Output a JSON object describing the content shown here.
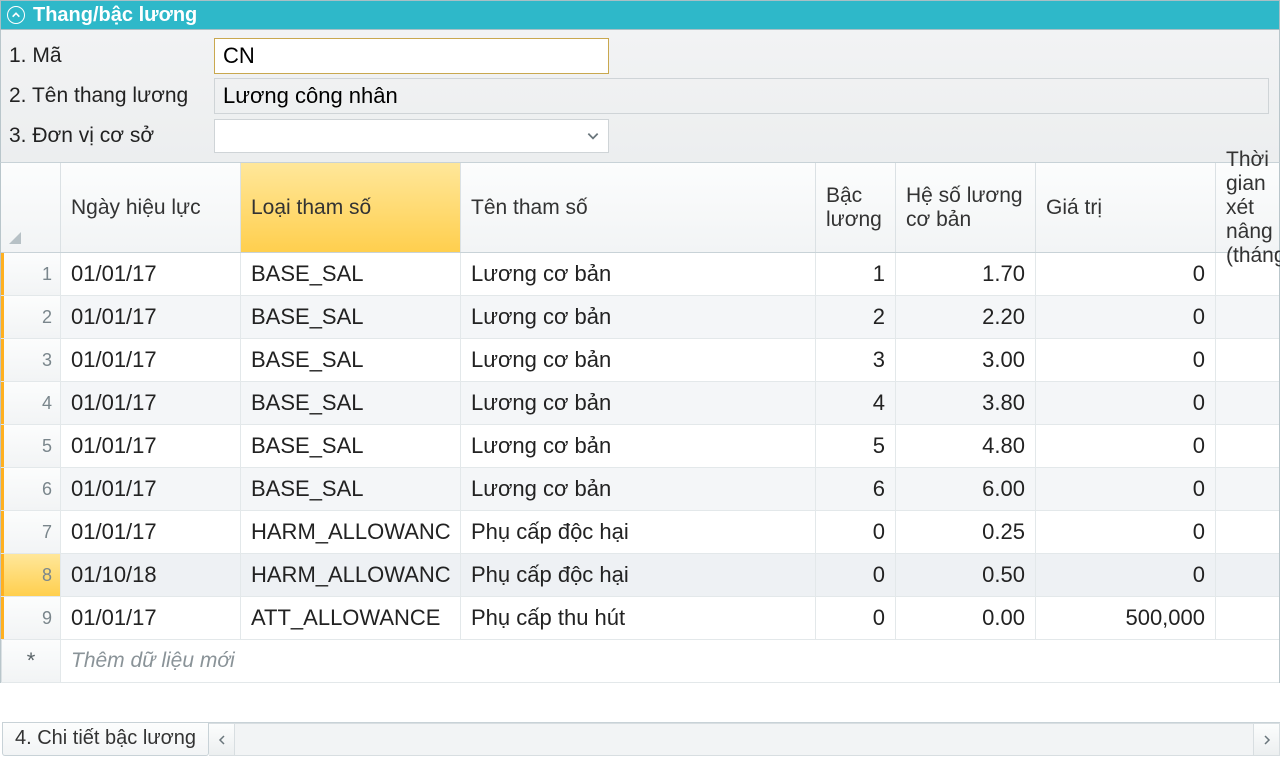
{
  "panel": {
    "title": "Thang/bậc lương"
  },
  "form": {
    "labels": {
      "code": "1. Mã",
      "name": "2. Tên thang lương",
      "unit": "3. Đơn vị cơ sở"
    },
    "values": {
      "code": "CN",
      "name": "Lương công nhân",
      "unit": ""
    }
  },
  "grid": {
    "columns": {
      "date": "Ngày hiệu lực",
      "paramType": "Loại tham số",
      "paramName": "Tên tham số",
      "level": "Bậc lương",
      "coef": "Hệ số lương cơ bản",
      "value": "Giá trị",
      "period": "Thời gian xét nâng (tháng)"
    },
    "rows": [
      {
        "n": "1",
        "date": "01/01/17",
        "type": "BASE_SAL",
        "name": "Lương cơ bản",
        "level": "1",
        "coef": "1.70",
        "value": "0",
        "period": ""
      },
      {
        "n": "2",
        "date": "01/01/17",
        "type": "BASE_SAL",
        "name": "Lương cơ bản",
        "level": "2",
        "coef": "2.20",
        "value": "0",
        "period": ""
      },
      {
        "n": "3",
        "date": "01/01/17",
        "type": "BASE_SAL",
        "name": "Lương cơ bản",
        "level": "3",
        "coef": "3.00",
        "value": "0",
        "period": ""
      },
      {
        "n": "4",
        "date": "01/01/17",
        "type": "BASE_SAL",
        "name": "Lương cơ bản",
        "level": "4",
        "coef": "3.80",
        "value": "0",
        "period": ""
      },
      {
        "n": "5",
        "date": "01/01/17",
        "type": "BASE_SAL",
        "name": "Lương cơ bản",
        "level": "5",
        "coef": "4.80",
        "value": "0",
        "period": ""
      },
      {
        "n": "6",
        "date": "01/01/17",
        "type": "BASE_SAL",
        "name": "Lương cơ bản",
        "level": "6",
        "coef": "6.00",
        "value": "0",
        "period": ""
      },
      {
        "n": "7",
        "date": "01/01/17",
        "type": "HARM_ALLOWANC",
        "name": "Phụ cấp độc hại",
        "level": "0",
        "coef": "0.25",
        "value": "0",
        "period": ""
      },
      {
        "n": "8",
        "date": "01/10/18",
        "type": "HARM_ALLOWANC",
        "name": "Phụ cấp độc hại",
        "level": "0",
        "coef": "0.50",
        "value": "0",
        "period": ""
      },
      {
        "n": "9",
        "date": "01/01/17",
        "type": "ATT_ALLOWANCE",
        "name": "Phụ cấp thu hút",
        "level": "0",
        "coef": "0.00",
        "value": "500,000",
        "period": ""
      }
    ],
    "newRowPlaceholder": "Thêm dữ liệu mới",
    "selectedRow": 8
  },
  "footer": {
    "tab": "4. Chi tiết bậc lương"
  }
}
